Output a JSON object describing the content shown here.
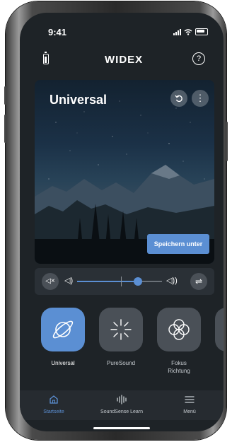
{
  "status_bar": {
    "time": "9:41"
  },
  "header": {
    "logo_text": "WIDEX",
    "help_glyph": "?"
  },
  "program": {
    "title": "Universal",
    "undo_icon": "undo-icon",
    "more_glyph": "⋮",
    "save_label": "Speichern unter"
  },
  "volume": {
    "mute_glyph": "◁×",
    "low_glyph": "◁)",
    "high_glyph": "◁))",
    "eq_glyph": "⇌",
    "level": 0.72
  },
  "programs": [
    {
      "label": "Universal",
      "icon": "planet-icon",
      "active": true
    },
    {
      "label": "PureSound",
      "icon": "sparkle-icon",
      "active": false
    },
    {
      "label": "Fokus\nRichtung",
      "icon": "clover-icon",
      "active": false
    }
  ],
  "nav": {
    "items": [
      {
        "label": "Startseite",
        "icon": "home-icon",
        "active": true
      },
      {
        "label": "SoundSense Learn",
        "icon": "waveform-icon",
        "active": false
      },
      {
        "label": "Menü",
        "icon": "menu-icon",
        "active": false
      }
    ]
  },
  "colors": {
    "accent": "#5b8fd3",
    "background": "#1e2327",
    "tile": "#4a5057"
  }
}
